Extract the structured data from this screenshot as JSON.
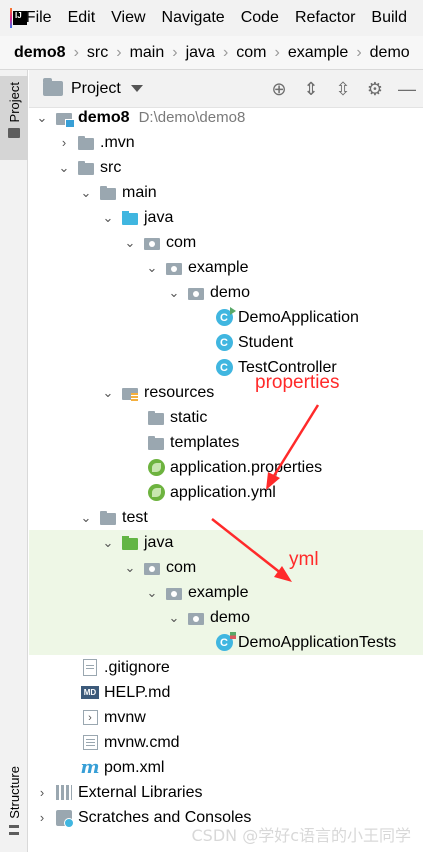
{
  "menu": {
    "items": [
      "File",
      "Edit",
      "View",
      "Navigate",
      "Code",
      "Refactor",
      "Build"
    ]
  },
  "breadcrumb": [
    "demo8",
    "src",
    "main",
    "java",
    "com",
    "example",
    "demo"
  ],
  "toolstrip": {
    "project_tab": "Project",
    "structure_tab": "Structure"
  },
  "project_header": {
    "title": "Project",
    "icons": [
      "locate-icon",
      "expand-all-icon",
      "collapse-all-icon",
      "gear-icon",
      "minimize-icon"
    ]
  },
  "tree": [
    {
      "label": "demo8",
      "path": "D:\\demo\\demo8",
      "icon": "module-folder"
    },
    {
      "label": ".mvn",
      "icon": "folder"
    },
    {
      "label": "src",
      "icon": "folder"
    },
    {
      "label": "main",
      "icon": "folder"
    },
    {
      "label": "java",
      "icon": "source-folder"
    },
    {
      "label": "com",
      "icon": "package"
    },
    {
      "label": "example",
      "icon": "package"
    },
    {
      "label": "demo",
      "icon": "package"
    },
    {
      "label": "DemoApplication",
      "icon": "spring-boot-class"
    },
    {
      "label": "Student",
      "icon": "class"
    },
    {
      "label": "TestController",
      "icon": "class"
    },
    {
      "label": "resources",
      "icon": "resources-folder"
    },
    {
      "label": "static",
      "icon": "folder"
    },
    {
      "label": "templates",
      "icon": "folder"
    },
    {
      "label": "application.properties",
      "icon": "spring-config"
    },
    {
      "label": "application.yml",
      "icon": "spring-config"
    },
    {
      "label": "test",
      "icon": "folder"
    },
    {
      "label": "java",
      "icon": "test-source-folder"
    },
    {
      "label": "com",
      "icon": "package"
    },
    {
      "label": "example",
      "icon": "package"
    },
    {
      "label": "demo",
      "icon": "package"
    },
    {
      "label": "DemoApplicationTests",
      "icon": "test-class"
    },
    {
      "label": ".gitignore",
      "icon": "text-file"
    },
    {
      "label": "HELP.md",
      "icon": "markdown-file"
    },
    {
      "label": "mvnw",
      "icon": "shell-file"
    },
    {
      "label": "mvnw.cmd",
      "icon": "cmd-file"
    },
    {
      "label": "pom.xml",
      "icon": "maven-file"
    },
    {
      "label": "External Libraries",
      "icon": "libraries"
    },
    {
      "label": "Scratches and Consoles",
      "icon": "scratches"
    }
  ],
  "annotations": {
    "properties": "properties",
    "yml": "yml"
  },
  "watermark": "CSDN @学好c语言的小王同学",
  "colors": {
    "annotation": "#ff2a2a",
    "test_highlight": "#eef7e6",
    "source_folder": "#40b6e0",
    "test_folder": "#62b543"
  }
}
